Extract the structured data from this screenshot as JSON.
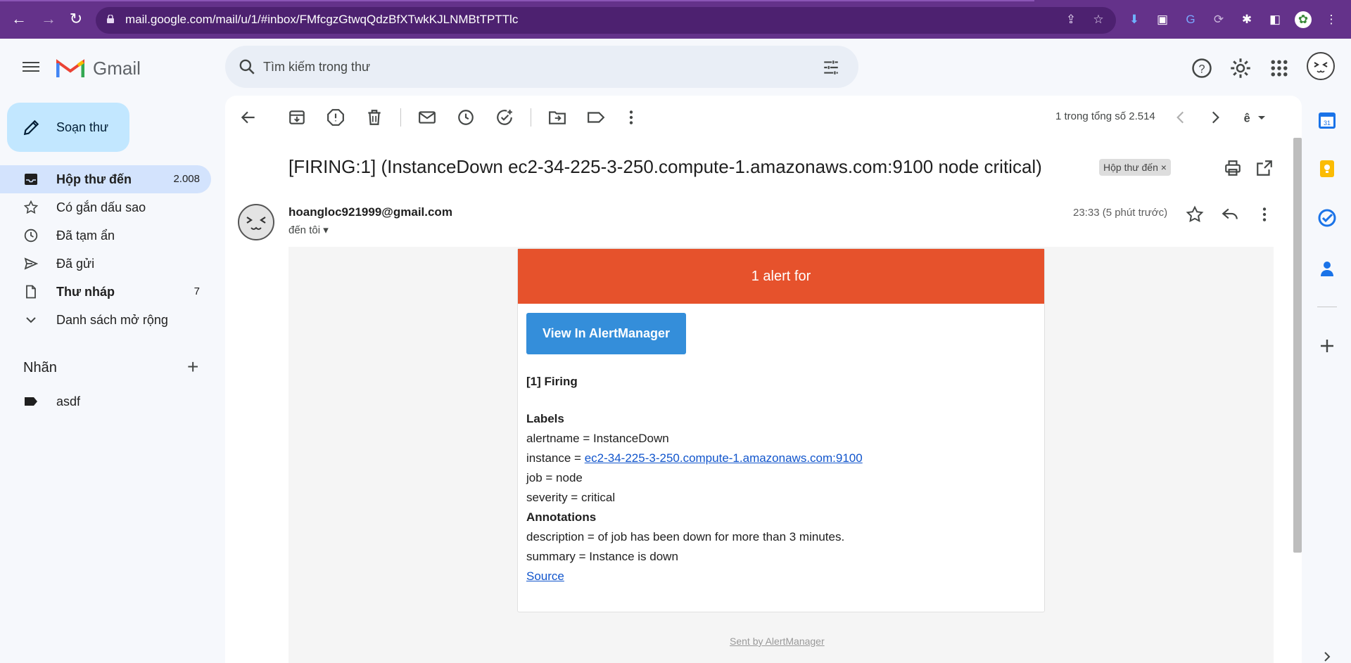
{
  "browser": {
    "url": "mail.google.com/mail/u/1/#inbox/FMfcgzGtwqQdzBfXTwkKJLNMBtTPTTlc"
  },
  "app": {
    "logo_text": "Gmail"
  },
  "search": {
    "placeholder": "Tìm kiếm trong thư"
  },
  "sidebar": {
    "compose_label": "Soạn thư",
    "items": [
      {
        "label": "Hộp thư đến",
        "count": "2.008",
        "icon": "inbox-icon"
      },
      {
        "label": "Có gắn dấu sao",
        "count": "",
        "icon": "star-icon"
      },
      {
        "label": "Đã tạm ẩn",
        "count": "",
        "icon": "clock-icon"
      },
      {
        "label": "Đã gửi",
        "count": "",
        "icon": "send-icon"
      },
      {
        "label": "Thư nháp",
        "count": "7",
        "icon": "draft-icon"
      },
      {
        "label": "Danh sách mở rộng",
        "count": "",
        "icon": "chevron-down-icon"
      }
    ],
    "labels_title": "Nhãn",
    "labels": [
      {
        "label": "asdf"
      }
    ]
  },
  "toolbar": {
    "pager": "1 trong tổng số 2.514"
  },
  "email": {
    "subject": "[FIRING:1] (InstanceDown ec2-34-225-3-250.compute-1.amazonaws.com:9100 node critical)",
    "inbox_chip": "Hộp thư đến",
    "inbox_chip_close": "×",
    "sender": "hoangloc921999@gmail.com",
    "to": "đến tôi",
    "time": "23:33 (5 phút trước)",
    "body": {
      "header": "1 alert for",
      "button": "View In AlertManager",
      "firing": "[1] Firing",
      "labels_heading": "Labels",
      "alertname": "alertname = InstanceDown",
      "instance_prefix": "instance = ",
      "instance_link": "ec2-34-225-3-250.compute-1.amazonaws.com:9100",
      "job": "job = node",
      "severity": "severity = critical",
      "annotations_heading": "Annotations",
      "description": "description = of job has been down for more than 3 minutes.",
      "summary": "summary = Instance is down",
      "source": "Source",
      "footer": "Sent by AlertManager"
    }
  },
  "colors": {
    "chrome": "#64328a",
    "alert_header": "#e6522c",
    "am_button": "#348eda",
    "compose": "#c2e7ff",
    "active_item": "#d3e3fd"
  }
}
